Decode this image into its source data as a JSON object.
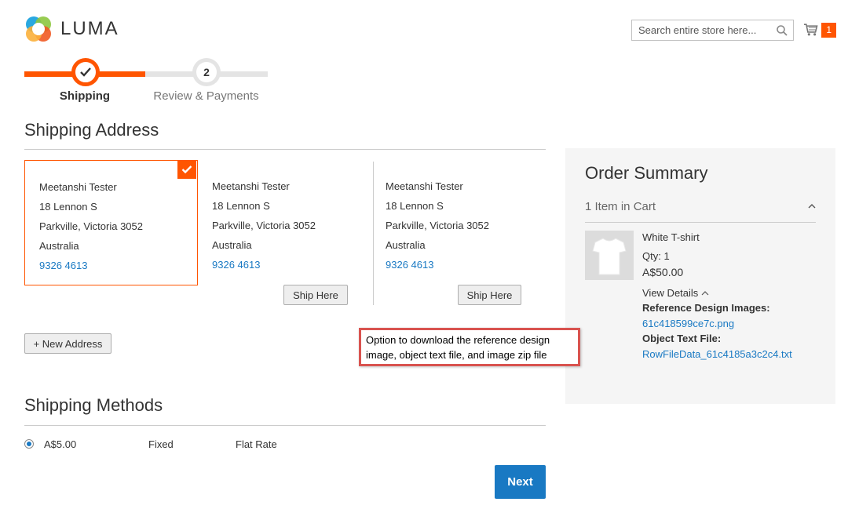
{
  "header": {
    "logo_text": "LUMA",
    "search_placeholder": "Search entire store here...",
    "cart_count": "1"
  },
  "progress": {
    "steps": [
      {
        "number": "",
        "label": "Shipping",
        "state": "done"
      },
      {
        "number": "2",
        "label": "Review & Payments",
        "state": "upcoming"
      }
    ]
  },
  "shipping_address": {
    "title": "Shipping Address",
    "addresses": [
      {
        "name": "Meetanshi Tester",
        "street": "18 Lennon S",
        "city": "Parkville, Victoria 3052",
        "country": "Australia",
        "phone": "9326 4613",
        "selected": true
      },
      {
        "name": "Meetanshi Tester",
        "street": "18 Lennon S",
        "city": "Parkville, Victoria 3052",
        "country": "Australia",
        "phone": "9326 4613",
        "selected": false,
        "button": "Ship Here"
      },
      {
        "name": "Meetanshi Tester",
        "street": "18 Lennon S",
        "city": "Parkville, Victoria 3052",
        "country": "Australia",
        "phone": "9326 4613",
        "selected": false,
        "button": "Ship Here"
      }
    ],
    "new_address_label": "+ New Address"
  },
  "shipping_methods": {
    "title": "Shipping Methods",
    "methods": [
      {
        "price": "A$5.00",
        "method": "Fixed",
        "carrier": "Flat Rate",
        "selected": true
      }
    ],
    "next_label": "Next"
  },
  "order_summary": {
    "title": "Order Summary",
    "items_in_cart": "1 Item in Cart",
    "item": {
      "name": "White T-shirt",
      "qty": "Qty: 1",
      "price": "A$50.00",
      "view_details": "View Details",
      "options": [
        {
          "label": "Reference Design Images:",
          "value": "61c418599ce7c.png"
        },
        {
          "label": "Object Text File:",
          "value": "RowFileData_61c4185a3c2c4.txt"
        }
      ]
    }
  },
  "callout": {
    "line1": "Option to download the reference design",
    "line2": "image, object text file, and image zip file"
  },
  "colors": {
    "accent": "#ff5501",
    "link": "#1979c3",
    "summary_bg": "#f5f5f5",
    "callout_border": "#d9534f"
  },
  "icons": [
    "luma-logo-icon",
    "search-icon",
    "cart-icon",
    "checkmark-icon",
    "chevron-up-icon",
    "tshirt-icon"
  ]
}
